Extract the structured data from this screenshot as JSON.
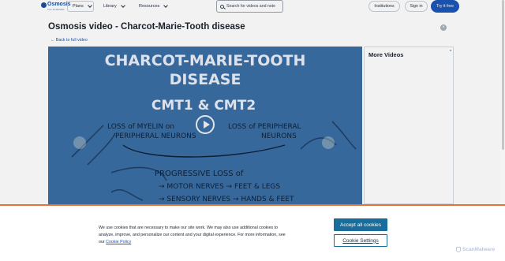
{
  "header": {
    "logo_text": "Osmosis",
    "logo_sub": "from ELSEVIER",
    "nav": [
      {
        "label": "Plans"
      },
      {
        "label": "Library"
      },
      {
        "label": "Resources"
      }
    ],
    "search_placeholder": "Search for videos and note",
    "institutions_label": "Institutions",
    "signin_label": "Sign in",
    "try_label": "Try it free"
  },
  "page": {
    "title": "Osmosis video - Charcot-Marie-Tooth disease",
    "back_link": "Back to full video",
    "close_glyph": "×"
  },
  "video": {
    "board_title_line1": "CHARCOT-MARIE-TOOTH",
    "board_title_line2": "DISEASE",
    "subtypes": "CMT1 & CMT2",
    "left_note_line1": "LOSS of MYELIN on",
    "left_note_line2": "PERIPHERAL NEURONS",
    "right_note_line1": "LOSS of PERIPHERAL",
    "right_note_line2": "NEURONS",
    "progressive_line1": "PROGRESSIVE LOSS of",
    "progressive_line2": "→ MOTOR NERVES → FEET & LEGS",
    "progressive_line3": "→ SENSORY NERVES → HANDS & FEET"
  },
  "sidebar": {
    "title": "More Videos"
  },
  "cookie": {
    "text": "We use cookies that are necessary to make our site work. We may also use additional cookies to analyze, improve, and personalize our content and your digital experience. For more information, see our ",
    "link": "Cookie Policy",
    "accept_label": "Accept all cookies",
    "settings_label": "Cookie Settings"
  },
  "watermark": "ScanMalware",
  "colors": {
    "brand_blue": "#1b56b8",
    "video_bg": "#3a6ea5",
    "cookie_button": "#1a6c9a",
    "cookie_border": "#e8703a"
  }
}
